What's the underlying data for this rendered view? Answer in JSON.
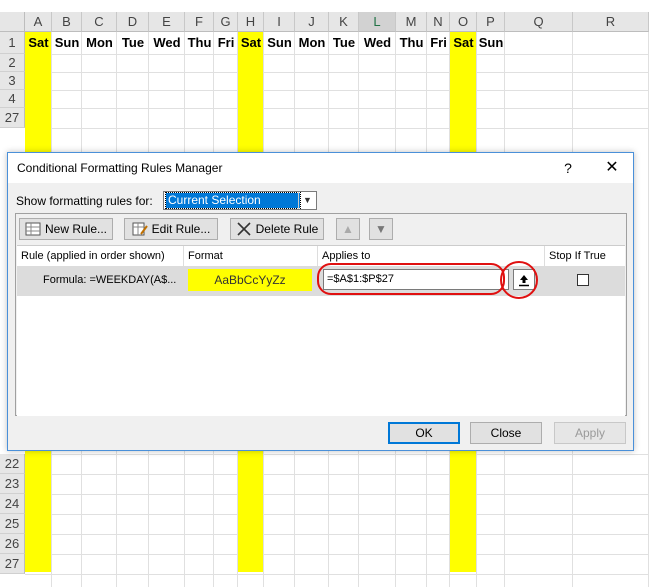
{
  "sheet": {
    "columns": [
      "A",
      "B",
      "C",
      "D",
      "E",
      "F",
      "G",
      "H",
      "I",
      "J",
      "K",
      "L",
      "M",
      "N",
      "O",
      "P",
      "Q",
      "R"
    ],
    "selected_column": "L",
    "visible_rows_top": [
      "1",
      "2",
      "3",
      "4",
      "27"
    ],
    "visible_rows_bottom": [
      "22",
      "23",
      "24",
      "25",
      "26",
      "27"
    ],
    "row1_days": [
      "Sat",
      "Sun",
      "Mon",
      "Tue",
      "Wed",
      "Thu",
      "Fri",
      "Sat",
      "Sun",
      "Mon",
      "Tue",
      "Wed",
      "Thu",
      "Fri",
      "Sat",
      "Sun"
    ],
    "highlight_color": "#ffff00"
  },
  "dialog": {
    "title": "Conditional Formatting Rules Manager",
    "help_label": "?",
    "close_label": "✕",
    "show_rules_label": "Show formatting rules for:",
    "show_rules_value": "Current Selection",
    "buttons": {
      "new_rule": "New Rule...",
      "edit_rule": "Edit Rule...",
      "delete_rule": "Delete Rule",
      "move_up": "▲",
      "move_down": "▼",
      "ok": "OK",
      "close": "Close",
      "apply": "Apply"
    },
    "table": {
      "headers": [
        "Rule (applied in order shown)",
        "Format",
        "Applies to",
        "Stop If True"
      ],
      "rows": [
        {
          "rule": "Formula: =WEEKDAY(A$...",
          "format_preview": "AaBbCcYyZz",
          "format_color": "#ffff00",
          "applies_to": "=$A$1:$P$27",
          "stop_if_true": false
        }
      ]
    },
    "annotation_color": "#e01010"
  }
}
